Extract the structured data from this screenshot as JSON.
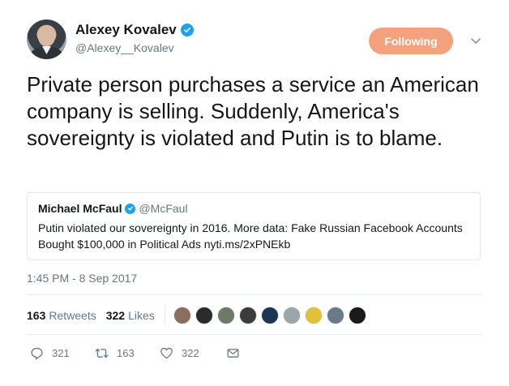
{
  "author": {
    "name": "Alexey Kovalev",
    "handle": "@Alexey__Kovalev",
    "verified": true
  },
  "follow_button": {
    "label": "Following",
    "color": "#f4a27e"
  },
  "tweet": {
    "text": "Private person purchases a service an American company is selling. Suddenly, America's sovereignty is violated and Putin is to blame.",
    "timestamp": "1:45 PM - 8 Sep 2017"
  },
  "quoted_tweet": {
    "name": "Michael McFaul",
    "handle": "@McFaul",
    "verified": true,
    "text": "Putin violated our sovereignty in 2016. More data: Fake Russian Facebook Accounts Bought $100,000 in Political Ads nyti.ms/2xPNEkb"
  },
  "stats": {
    "retweets_count": "163",
    "retweets_label": "Retweets",
    "likes_count": "322",
    "likes_label": "Likes"
  },
  "likers": [
    {
      "color": "#8b6f5e"
    },
    {
      "color": "#2b2b2b"
    },
    {
      "color": "#6f7a66"
    },
    {
      "color": "#3c3c3c"
    },
    {
      "color": "#1f3554"
    },
    {
      "color": "#9aa6a8"
    },
    {
      "color": "#e0c23a"
    },
    {
      "color": "#6b7b86"
    },
    {
      "color": "#1a1a1a"
    }
  ],
  "actions": {
    "replies": "321",
    "retweets": "163",
    "likes": "322"
  },
  "colors": {
    "verified": "#1da1f2",
    "secondary_text": "#657786",
    "primary_text": "#14171a"
  }
}
